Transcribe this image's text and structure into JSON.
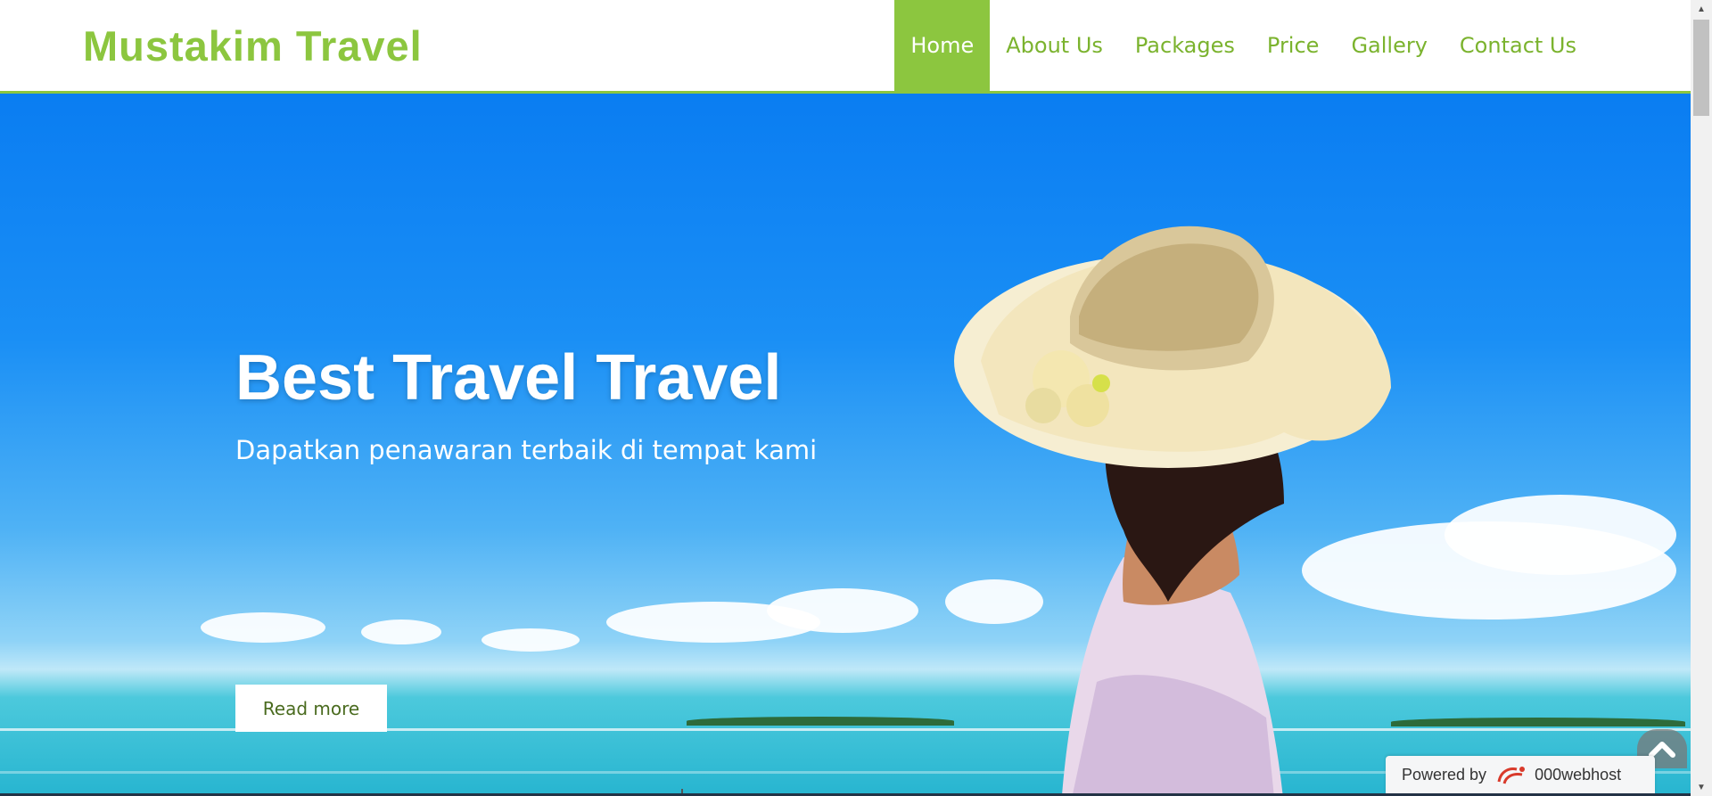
{
  "site": {
    "brand": "Mustakim Travel"
  },
  "nav": {
    "items": [
      {
        "label": "Home",
        "active": true
      },
      {
        "label": "About Us"
      },
      {
        "label": "Packages"
      },
      {
        "label": "Price"
      },
      {
        "label": "Gallery"
      },
      {
        "label": "Contact Us"
      }
    ]
  },
  "hero": {
    "title": "Best Travel Travel",
    "subtitle": "Dapatkan penawaran terbaik di tempat kami",
    "button_label": "Read more"
  },
  "footer_badge": {
    "prefix": "Powered by",
    "host": "000webhost"
  },
  "icons": {
    "to_top": "chevron-up-icon",
    "host_logo": "000webhost-logo-icon",
    "scroll_up": "scroll-up-arrow-icon",
    "scroll_down": "scroll-down-arrow-icon"
  },
  "colors": {
    "accent": "#8cc63f",
    "nav_text": "#7bb32e",
    "sky": "#0a7df2",
    "button_text": "#4a6b1f"
  }
}
